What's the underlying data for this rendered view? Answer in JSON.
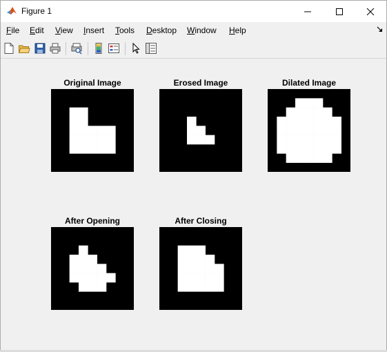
{
  "window": {
    "title": "Figure 1",
    "controls": [
      "minimize-icon",
      "maximize-icon",
      "close-icon"
    ]
  },
  "menu": {
    "items": [
      {
        "label_first": "F",
        "label_rest": "ile"
      },
      {
        "label_first": "E",
        "label_rest": "dit"
      },
      {
        "label_first": "V",
        "label_rest": "iew"
      },
      {
        "label_first": "I",
        "label_rest": "nsert"
      },
      {
        "label_first": "T",
        "label_rest": "ools"
      },
      {
        "label_first": "D",
        "label_rest": "esktop"
      },
      {
        "label_first": "W",
        "label_rest": "indow"
      },
      {
        "label_first": "H",
        "label_rest": "elp"
      }
    ]
  },
  "toolbar": {
    "icons": [
      "new-figure-icon",
      "open-file-icon",
      "save-icon",
      "print-icon",
      "print-preview-icon",
      "colorbar-icon",
      "legend-icon",
      "pointer-icon",
      "property-inspector-icon"
    ]
  },
  "subplots": [
    {
      "title": "Original Image",
      "grid": 9,
      "mask": [
        "000000000",
        "000000000",
        "001100000",
        "001100000",
        "001111100",
        "001111100",
        "001111100",
        "000000000",
        "000000000"
      ]
    },
    {
      "title": "Erosed Image",
      "grid": 9,
      "mask": [
        "000000000",
        "000000000",
        "000000000",
        "000100000",
        "000110000",
        "000111000",
        "000000000",
        "000000000",
        "000000000"
      ]
    },
    {
      "title": "Dilated Image",
      "grid": 9,
      "mask": [
        "000000000",
        "000111000",
        "001111100",
        "011111110",
        "011111110",
        "011111110",
        "011111110",
        "001111100",
        "000000000"
      ]
    },
    {
      "title": "After Opening",
      "grid": 9,
      "mask": [
        "000000000",
        "000000000",
        "000100000",
        "001110000",
        "001111000",
        "001111100",
        "000111000",
        "000000000",
        "000000000"
      ]
    },
    {
      "title": "After Closing",
      "grid": 9,
      "mask": [
        "000000000",
        "000000000",
        "001110000",
        "001111000",
        "001111100",
        "001111100",
        "001111100",
        "000000000",
        "000000000"
      ]
    }
  ],
  "colors": {
    "background": "#000000",
    "foreground": "#ffffff",
    "matlab_orange": "#d95319"
  }
}
